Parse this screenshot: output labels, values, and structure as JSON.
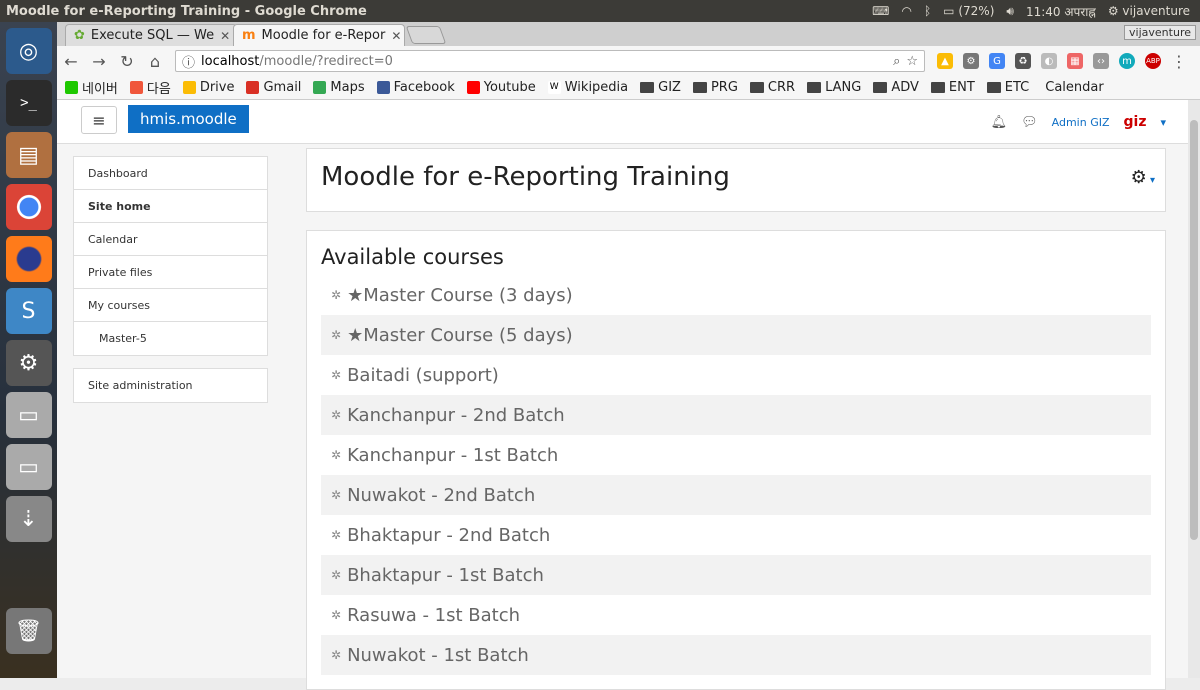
{
  "system": {
    "window_title": "Moodle for e-Reporting Training - Google Chrome",
    "battery": "(72%)",
    "time": "11:40 अपराह्न",
    "user": "vijaventure"
  },
  "tabs": [
    {
      "label": "Execute SQL — We"
    },
    {
      "label": "Moodle for e-Repor"
    }
  ],
  "profile_badge": "vijaventure",
  "address": {
    "host": "localhost",
    "path": "/moodle/?redirect=0"
  },
  "bookmarks": [
    {
      "label": "네이버",
      "icon": "naver-icon",
      "color": "#1ec800"
    },
    {
      "label": "다음",
      "icon": "daum-icon",
      "color": "#f0563b"
    },
    {
      "label": "Drive",
      "icon": "drive-icon",
      "color": "#fbbc05"
    },
    {
      "label": "Gmail",
      "icon": "gmail-icon",
      "color": "#d93025"
    },
    {
      "label": "Maps",
      "icon": "maps-icon",
      "color": "#34a853"
    },
    {
      "label": "Facebook",
      "icon": "facebook-icon",
      "color": "#3b5998"
    },
    {
      "label": "Youtube",
      "icon": "youtube-icon",
      "color": "#ff0000"
    },
    {
      "label": "Wikipedia",
      "icon": "wikipedia-icon",
      "color": "#ffffff"
    },
    {
      "label": "GIZ",
      "icon": "folder-icon"
    },
    {
      "label": "PRG",
      "icon": "folder-icon"
    },
    {
      "label": "CRR",
      "icon": "folder-icon"
    },
    {
      "label": "LANG",
      "icon": "folder-icon"
    },
    {
      "label": "ADV",
      "icon": "folder-icon"
    },
    {
      "label": "ENT",
      "icon": "folder-icon"
    },
    {
      "label": "ETC",
      "icon": "folder-icon"
    },
    {
      "label": "Calendar",
      "icon": "apple-icon"
    }
  ],
  "moodle": {
    "brand": "hmis.moodle",
    "user_name": "Admin GIZ",
    "user_logo": "giz",
    "nav": [
      {
        "label": "Dashboard",
        "style": ""
      },
      {
        "label": "Site home",
        "style": "bold"
      },
      {
        "label": "Calendar",
        "style": ""
      },
      {
        "label": "Private files",
        "style": ""
      },
      {
        "label": "My courses",
        "style": ""
      },
      {
        "label": "Master-5",
        "style": "sub"
      }
    ],
    "admin_nav": "Site administration",
    "page_title": "Moodle for e-Reporting Training",
    "courses_heading": "Available courses",
    "courses": [
      "★Master Course (3 days)",
      "★Master Course (5 days)",
      "Baitadi (support)",
      "Kanchanpur - 2nd Batch",
      "Kanchanpur - 1st Batch",
      "Nuwakot - 2nd Batch",
      "Bhaktapur - 2nd Batch",
      "Bhaktapur - 1st Batch",
      "Rasuwa - 1st Batch",
      "Nuwakot - 1st Batch"
    ]
  }
}
